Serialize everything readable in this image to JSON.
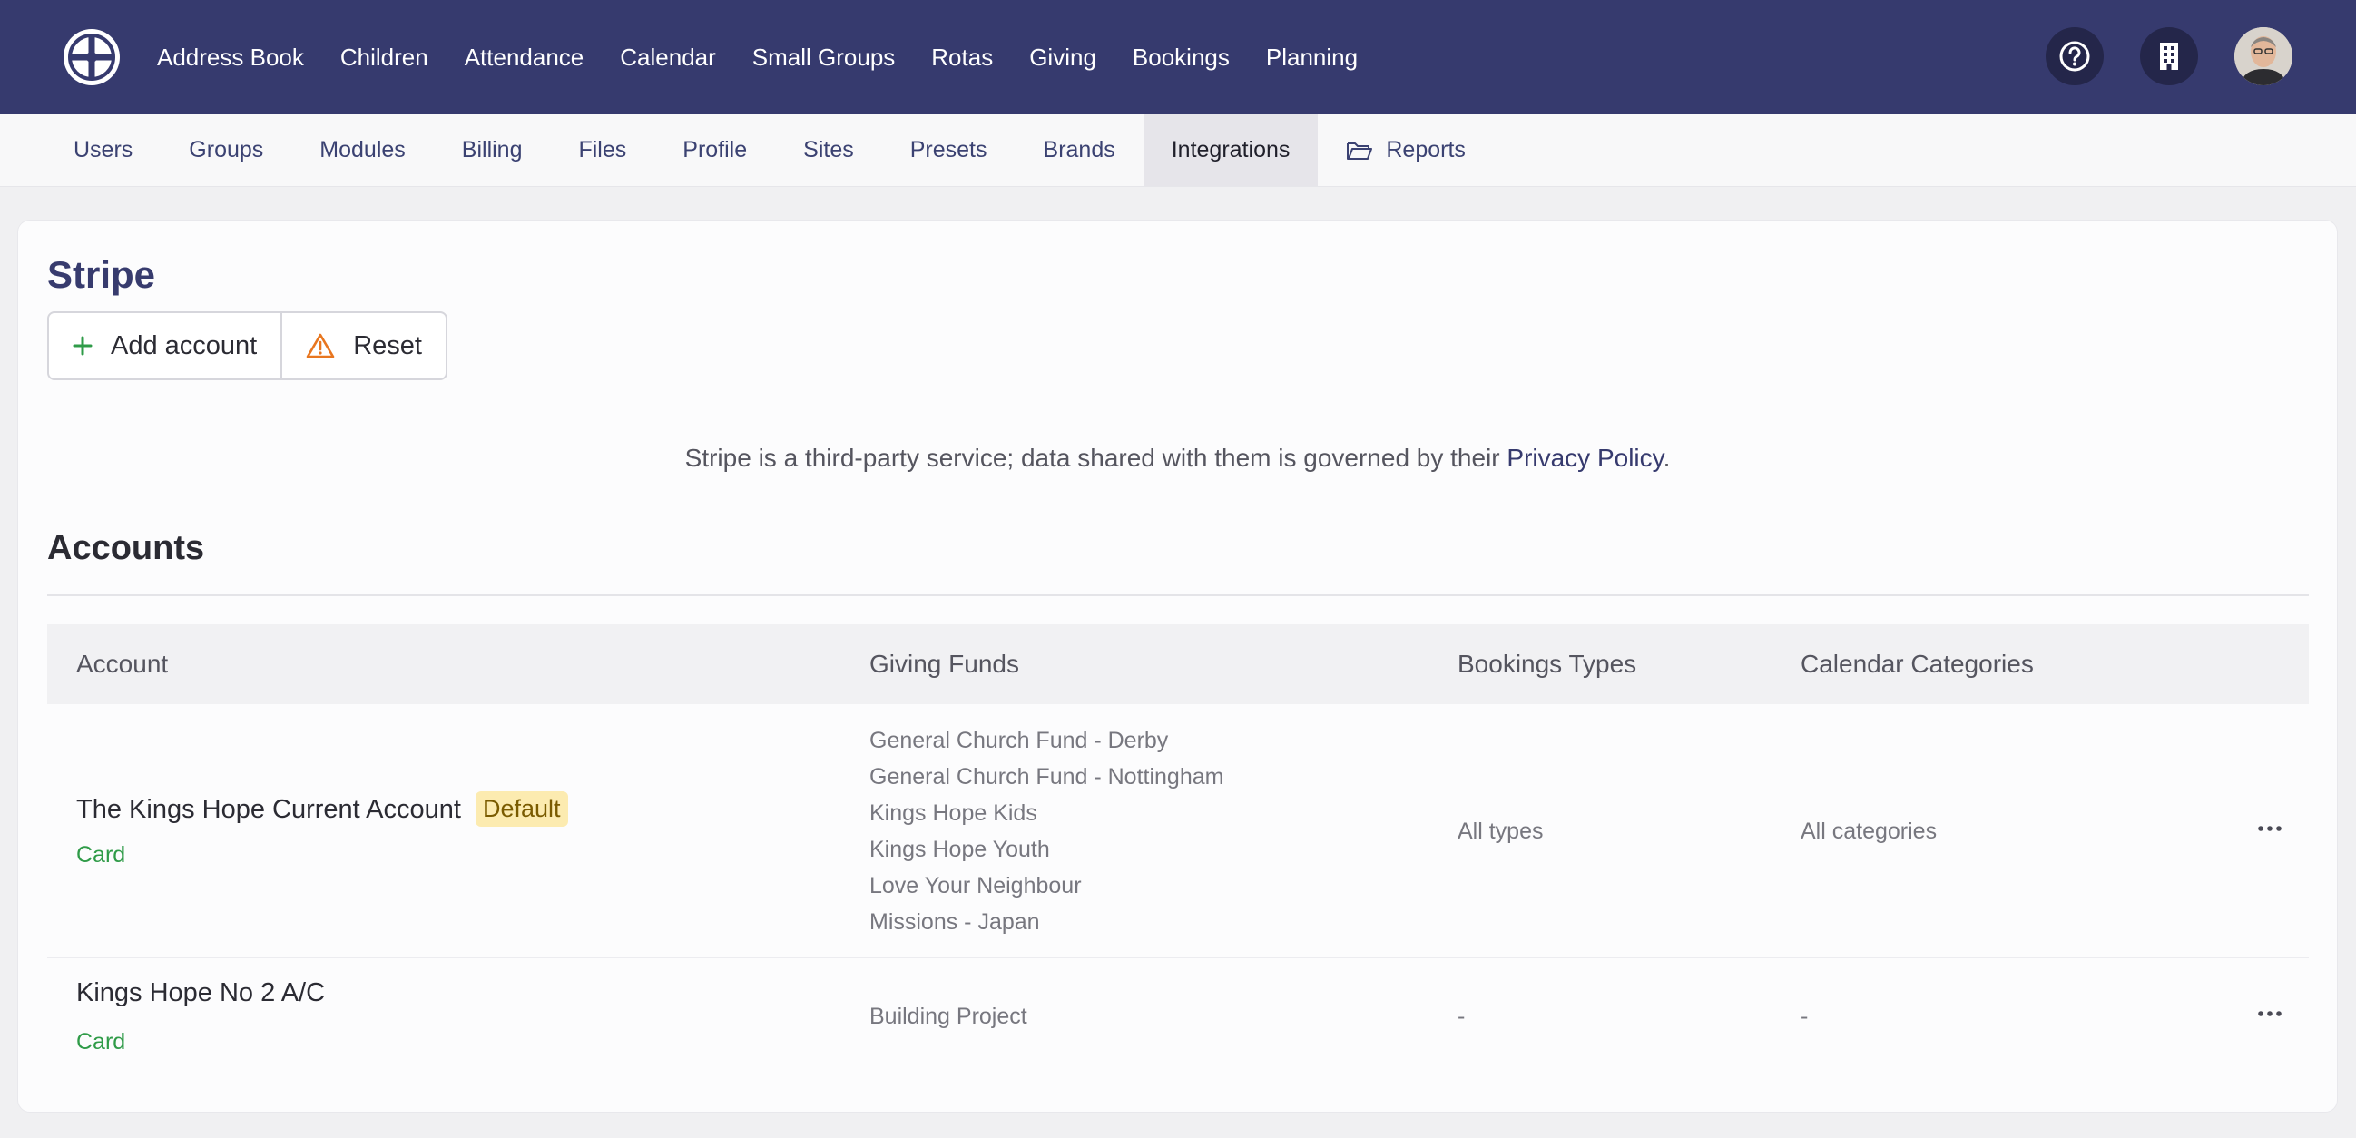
{
  "topnav": {
    "items": [
      "Address Book",
      "Children",
      "Attendance",
      "Calendar",
      "Small Groups",
      "Rotas",
      "Giving",
      "Bookings",
      "Planning"
    ],
    "icons": [
      "logo-icon",
      "help-icon",
      "building-icon",
      "avatar"
    ]
  },
  "subnav": {
    "tabs": [
      "Users",
      "Groups",
      "Modules",
      "Billing",
      "Files",
      "Profile",
      "Sites",
      "Presets",
      "Brands",
      "Integrations",
      "Reports"
    ],
    "active": "Integrations"
  },
  "page": {
    "title": "Stripe",
    "add_label": "Add account",
    "reset_label": "Reset",
    "notice_text": "Stripe is a third-party service; data shared with them is governed by their",
    "notice_link": "Privacy Policy",
    "notice_end": ".",
    "section_title": "Accounts"
  },
  "table": {
    "headers": [
      "Account",
      "Giving Funds",
      "Bookings Types",
      "Calendar Categories"
    ],
    "rows": [
      {
        "name": "The Kings Hope Current Account",
        "badge": "Default",
        "type": "Card",
        "funds": [
          "General Church Fund - Derby",
          "General Church Fund - Nottingham",
          "Kings Hope Kids",
          "Kings Hope Youth",
          "Love Your Neighbour",
          "Missions - Japan"
        ],
        "bookings": "All types",
        "categories": "All categories"
      },
      {
        "name": "Kings Hope No 2 A/C",
        "type": "Card",
        "funds": [
          "Building Project"
        ],
        "bookings": "-",
        "categories": "-"
      }
    ]
  },
  "colors": {
    "topbar": "#363a6e",
    "accent_green": "#2f9b48",
    "badge_bg": "#fcebb0",
    "warning": "#e8761f"
  }
}
